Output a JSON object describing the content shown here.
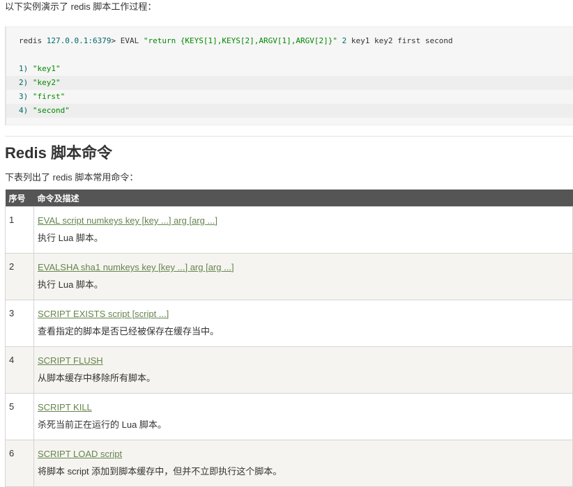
{
  "intro": "以下实例演示了 redis 脚本工作过程：",
  "code": {
    "command": {
      "prompt_host": "redis ",
      "prompt_ip": "127.0.0.1:6379",
      "prompt_rest": "> EVAL ",
      "script": "\"return {KEYS[1],KEYS[2],ARGV[1],ARGV[2]}\"",
      "space": " ",
      "numkeys": "2",
      "args": " key1 key2 first second"
    },
    "output": [
      {
        "num": "1) ",
        "value": "\"key1\""
      },
      {
        "num": "2) ",
        "value": "\"key2\""
      },
      {
        "num": "3) ",
        "value": "\"first\""
      },
      {
        "num": "4) ",
        "value": "\"second\""
      }
    ]
  },
  "section": {
    "title": "Redis 脚本命令",
    "description": "下表列出了 redis 脚本常用命令："
  },
  "table": {
    "headers": [
      "序号",
      "命令及描述"
    ],
    "rows": [
      {
        "num": "1",
        "command": "EVAL script numkeys key [key ...] arg [arg ...]",
        "description": "执行 Lua 脚本。"
      },
      {
        "num": "2",
        "command": "EVALSHA sha1 numkeys key [key ...] arg [arg ...]",
        "description": "执行 Lua 脚本。"
      },
      {
        "num": "3",
        "command": "SCRIPT EXISTS script [script ...]",
        "description": "查看指定的脚本是否已经被保存在缓存当中。"
      },
      {
        "num": "4",
        "command": "SCRIPT FLUSH",
        "description": "从脚本缓存中移除所有脚本。"
      },
      {
        "num": "5",
        "command": "SCRIPT KILL",
        "description": "杀死当前正在运行的 Lua 脚本。"
      },
      {
        "num": "6",
        "command": "SCRIPT LOAD script",
        "description": "将脚本 script 添加到脚本缓存中，但并不立即执行这个脚本。"
      }
    ]
  }
}
